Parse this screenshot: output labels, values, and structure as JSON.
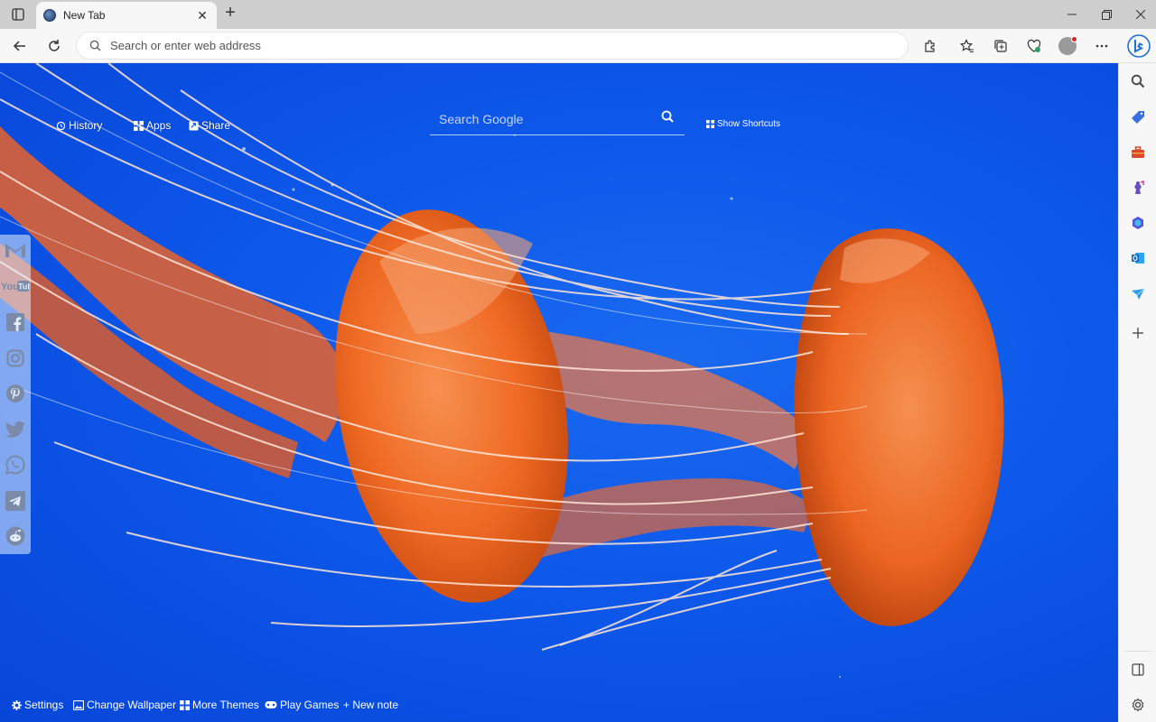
{
  "browser": {
    "tab_title": "New Tab",
    "address_placeholder": "Search or enter web address"
  },
  "newtab": {
    "quicklinks": {
      "history": "History",
      "apps": "Apps",
      "share": "Share"
    },
    "search_placeholder": "Search Google",
    "show_shortcuts": "Show Shortcuts",
    "bottom": {
      "settings": "Settings",
      "change_wallpaper": "Change Wallpaper",
      "more_themes": "More Themes",
      "play_games": "Play Games",
      "new_note": "+ New note"
    },
    "social_icons": [
      "gmail-icon",
      "youtube-icon",
      "facebook-icon",
      "instagram-icon",
      "pinterest-icon",
      "twitter-icon",
      "whatsapp-icon",
      "telegram-icon",
      "reddit-icon"
    ]
  },
  "sidebar_icons": [
    "search-icon",
    "shopping-tag-icon",
    "tools-icon",
    "games-icon",
    "office-icon",
    "outlook-icon",
    "drop-icon",
    "add-icon",
    "split-screen-icon",
    "settings-icon"
  ],
  "colors": {
    "wallpaper_blue": "#0d58ea",
    "jelly_orange": "#f06a24"
  }
}
